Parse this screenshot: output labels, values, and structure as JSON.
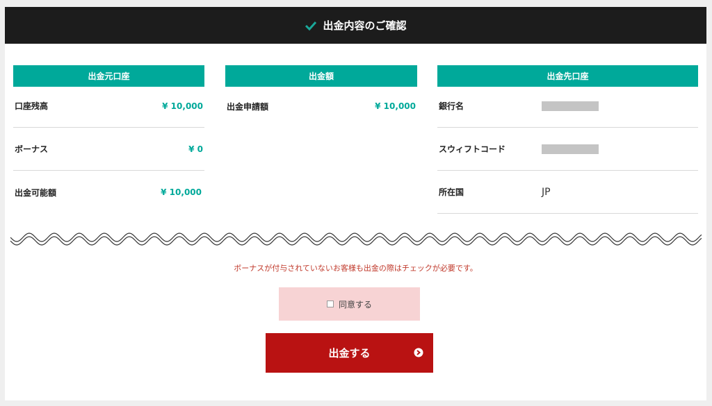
{
  "header": {
    "title": "出金内容のご確認"
  },
  "source": {
    "heading": "出金元口座",
    "rows": [
      {
        "label": "口座残高",
        "value": "¥ 10,000"
      },
      {
        "label": "ボーナス",
        "value": "¥ 0"
      },
      {
        "label": "出金可能額",
        "value": "¥ 10,000"
      }
    ]
  },
  "amount": {
    "heading": "出金額",
    "rows": [
      {
        "label": "出金申請額",
        "value": "¥ 10,000"
      }
    ]
  },
  "destination": {
    "heading": "出金先口座",
    "rows": [
      {
        "label": "銀行名",
        "value": ""
      },
      {
        "label": "スウィフトコード",
        "value": ""
      },
      {
        "label": "所在国",
        "value": "JP"
      }
    ]
  },
  "notice": "ボーナスが付与されていないお客様も出金の際はチェックが必要です。",
  "agree": {
    "label": "同意する",
    "checked": false
  },
  "submit": {
    "label": "出金する"
  },
  "colors": {
    "accent": "#00a99a",
    "header_bg": "#1c1c1c",
    "submit_bg": "#b91212",
    "agree_bg": "#f7d3d4",
    "notice": "#c0392b"
  }
}
